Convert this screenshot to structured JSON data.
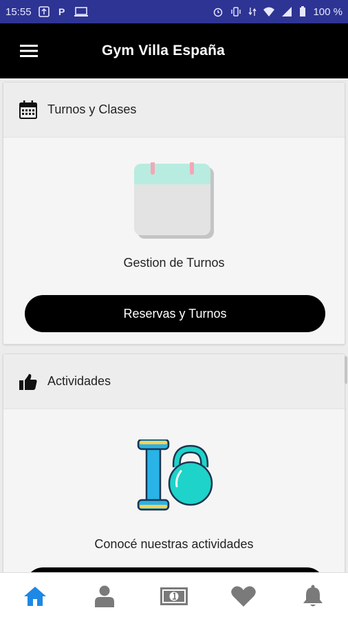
{
  "status_bar": {
    "time": "15:55",
    "battery": "100 %",
    "icons_left": [
      "usb-icon",
      "parking-app-icon",
      "cast-icon"
    ],
    "icons_right": [
      "alarm-icon",
      "vibrate-icon",
      "data-arrows-icon",
      "wifi-icon",
      "signal-icon",
      "battery-icon"
    ]
  },
  "app_bar": {
    "title": "Gym Villa España",
    "menu_icon": "hamburger-menu-icon"
  },
  "cards": [
    {
      "header_title": "Turnos y Clases",
      "header_icon": "calendar-icon",
      "illustration": "calendar-illustration",
      "caption": "Gestion de Turnos",
      "button_label": "Reservas y Turnos"
    },
    {
      "header_title": "Actividades",
      "header_icon": "thumbs-up-icon",
      "illustration": "dumbbell-kettlebell-illustration",
      "caption": "Conocé nuestras actividades"
    }
  ],
  "bottom_nav": {
    "items": [
      "home-icon",
      "user-icon",
      "money-icon",
      "heart-icon",
      "bell-icon"
    ],
    "active": "home-icon",
    "active_color": "#1e88e5",
    "inactive_color": "#7a7a7a"
  },
  "colors": {
    "status_bar": "#2e3493",
    "app_bar": "#000000",
    "calendar_top": "#b8ece0",
    "calendar_pins": "#f4a6b8",
    "kettlebell": "#1ed3c9",
    "dumbbell_bar": "#2ab3e6",
    "accent_yellow": "#ffd24a"
  }
}
